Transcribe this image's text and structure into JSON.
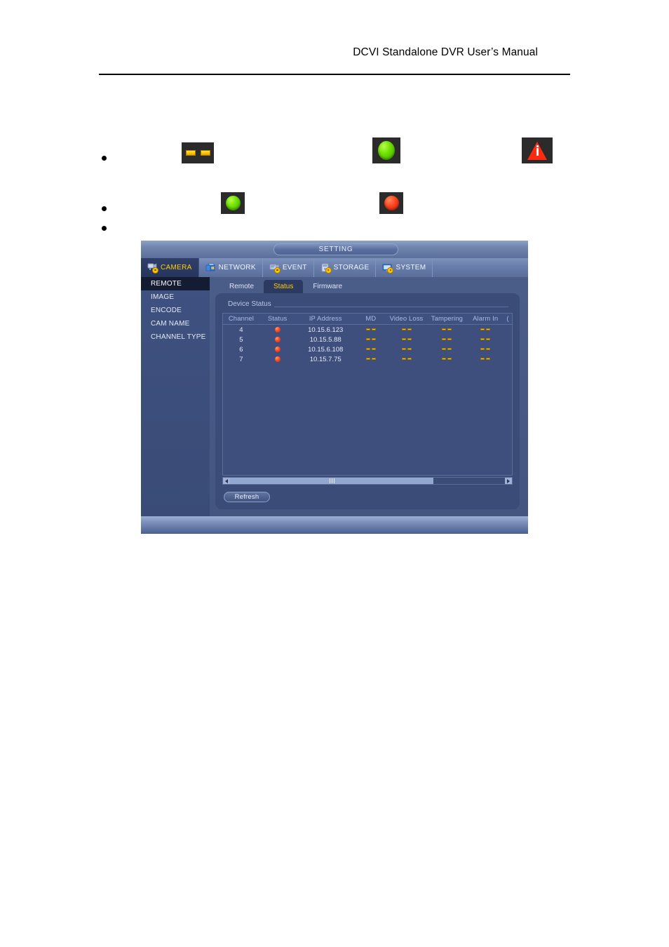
{
  "document": {
    "header_title": "DCVI Standalone DVR User’s Manual"
  },
  "manual_icons": {
    "dashes": "double-dash-yellow-icon",
    "green_large": "green-led-icon",
    "warning": "red-warning-triangle-icon",
    "green_small": "green-circle-icon",
    "red_small": "red-circle-icon"
  },
  "dvr": {
    "title": "SETTING",
    "menu": [
      {
        "label": "CAMERA",
        "icon": "camera-gear-icon",
        "active": true
      },
      {
        "label": "NETWORK",
        "icon": "network-icon",
        "active": false
      },
      {
        "label": "EVENT",
        "icon": "event-gear-icon",
        "active": false
      },
      {
        "label": "STORAGE",
        "icon": "storage-gear-icon",
        "active": false
      },
      {
        "label": "SYSTEM",
        "icon": "system-gear-icon",
        "active": false
      }
    ],
    "sidebar": [
      {
        "label": "REMOTE",
        "active": true
      },
      {
        "label": "IMAGE",
        "active": false
      },
      {
        "label": "ENCODE",
        "active": false
      },
      {
        "label": "CAM NAME",
        "active": false
      },
      {
        "label": "CHANNEL TYPE",
        "active": false
      }
    ],
    "tabs": [
      {
        "label": "Remote",
        "active": false
      },
      {
        "label": "Status",
        "active": true
      },
      {
        "label": "Firmware",
        "active": false
      }
    ],
    "panel": {
      "legend": "Device Status",
      "columns": [
        "Channel",
        "Status",
        "IP Address",
        "MD",
        "Video Loss",
        "Tampering",
        "Alarm In",
        "("
      ],
      "rows": [
        {
          "channel": "4",
          "status": "red-dot",
          "ip": "10.15.6.123",
          "md": "--",
          "video_loss": "--",
          "tampering": "--",
          "alarm_in": "--"
        },
        {
          "channel": "5",
          "status": "red-dot",
          "ip": "10.15.5.88",
          "md": "--",
          "video_loss": "--",
          "tampering": "--",
          "alarm_in": "--"
        },
        {
          "channel": "6",
          "status": "red-dot",
          "ip": "10.15.6.108",
          "md": "--",
          "video_loss": "--",
          "tampering": "--",
          "alarm_in": "--"
        },
        {
          "channel": "7",
          "status": "red-dot",
          "ip": "10.15.7.75",
          "md": "--",
          "video_loss": "--",
          "tampering": "--",
          "alarm_in": "--"
        }
      ],
      "refresh_label": "Refresh"
    },
    "colors": {
      "window_bg": "#485a86",
      "panel_bg": "#3b4c79",
      "active_tab_text": "#ffcc00",
      "status_red": "#ff4a22",
      "status_green": "#6ee000",
      "dash_yellow": "#ffc400"
    }
  }
}
